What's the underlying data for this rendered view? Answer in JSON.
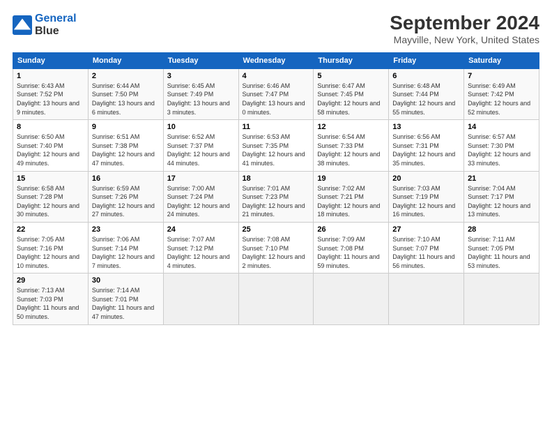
{
  "logo": {
    "line1": "General",
    "line2": "Blue"
  },
  "title": "September 2024",
  "subtitle": "Mayville, New York, United States",
  "days_of_week": [
    "Sunday",
    "Monday",
    "Tuesday",
    "Wednesday",
    "Thursday",
    "Friday",
    "Saturday"
  ],
  "weeks": [
    [
      {
        "day": 1,
        "sunrise": "6:43 AM",
        "sunset": "7:52 PM",
        "daylight": "13 hours and 9 minutes."
      },
      {
        "day": 2,
        "sunrise": "6:44 AM",
        "sunset": "7:50 PM",
        "daylight": "13 hours and 6 minutes."
      },
      {
        "day": 3,
        "sunrise": "6:45 AM",
        "sunset": "7:49 PM",
        "daylight": "13 hours and 3 minutes."
      },
      {
        "day": 4,
        "sunrise": "6:46 AM",
        "sunset": "7:47 PM",
        "daylight": "13 hours and 0 minutes."
      },
      {
        "day": 5,
        "sunrise": "6:47 AM",
        "sunset": "7:45 PM",
        "daylight": "12 hours and 58 minutes."
      },
      {
        "day": 6,
        "sunrise": "6:48 AM",
        "sunset": "7:44 PM",
        "daylight": "12 hours and 55 minutes."
      },
      {
        "day": 7,
        "sunrise": "6:49 AM",
        "sunset": "7:42 PM",
        "daylight": "12 hours and 52 minutes."
      }
    ],
    [
      {
        "day": 8,
        "sunrise": "6:50 AM",
        "sunset": "7:40 PM",
        "daylight": "12 hours and 49 minutes."
      },
      {
        "day": 9,
        "sunrise": "6:51 AM",
        "sunset": "7:38 PM",
        "daylight": "12 hours and 47 minutes."
      },
      {
        "day": 10,
        "sunrise": "6:52 AM",
        "sunset": "7:37 PM",
        "daylight": "12 hours and 44 minutes."
      },
      {
        "day": 11,
        "sunrise": "6:53 AM",
        "sunset": "7:35 PM",
        "daylight": "12 hours and 41 minutes."
      },
      {
        "day": 12,
        "sunrise": "6:54 AM",
        "sunset": "7:33 PM",
        "daylight": "12 hours and 38 minutes."
      },
      {
        "day": 13,
        "sunrise": "6:56 AM",
        "sunset": "7:31 PM",
        "daylight": "12 hours and 35 minutes."
      },
      {
        "day": 14,
        "sunrise": "6:57 AM",
        "sunset": "7:30 PM",
        "daylight": "12 hours and 33 minutes."
      }
    ],
    [
      {
        "day": 15,
        "sunrise": "6:58 AM",
        "sunset": "7:28 PM",
        "daylight": "12 hours and 30 minutes."
      },
      {
        "day": 16,
        "sunrise": "6:59 AM",
        "sunset": "7:26 PM",
        "daylight": "12 hours and 27 minutes."
      },
      {
        "day": 17,
        "sunrise": "7:00 AM",
        "sunset": "7:24 PM",
        "daylight": "12 hours and 24 minutes."
      },
      {
        "day": 18,
        "sunrise": "7:01 AM",
        "sunset": "7:23 PM",
        "daylight": "12 hours and 21 minutes."
      },
      {
        "day": 19,
        "sunrise": "7:02 AM",
        "sunset": "7:21 PM",
        "daylight": "12 hours and 18 minutes."
      },
      {
        "day": 20,
        "sunrise": "7:03 AM",
        "sunset": "7:19 PM",
        "daylight": "12 hours and 16 minutes."
      },
      {
        "day": 21,
        "sunrise": "7:04 AM",
        "sunset": "7:17 PM",
        "daylight": "12 hours and 13 minutes."
      }
    ],
    [
      {
        "day": 22,
        "sunrise": "7:05 AM",
        "sunset": "7:16 PM",
        "daylight": "12 hours and 10 minutes."
      },
      {
        "day": 23,
        "sunrise": "7:06 AM",
        "sunset": "7:14 PM",
        "daylight": "12 hours and 7 minutes."
      },
      {
        "day": 24,
        "sunrise": "7:07 AM",
        "sunset": "7:12 PM",
        "daylight": "12 hours and 4 minutes."
      },
      {
        "day": 25,
        "sunrise": "7:08 AM",
        "sunset": "7:10 PM",
        "daylight": "12 hours and 2 minutes."
      },
      {
        "day": 26,
        "sunrise": "7:09 AM",
        "sunset": "7:08 PM",
        "daylight": "11 hours and 59 minutes."
      },
      {
        "day": 27,
        "sunrise": "7:10 AM",
        "sunset": "7:07 PM",
        "daylight": "11 hours and 56 minutes."
      },
      {
        "day": 28,
        "sunrise": "7:11 AM",
        "sunset": "7:05 PM",
        "daylight": "11 hours and 53 minutes."
      }
    ],
    [
      {
        "day": 29,
        "sunrise": "7:13 AM",
        "sunset": "7:03 PM",
        "daylight": "11 hours and 50 minutes."
      },
      {
        "day": 30,
        "sunrise": "7:14 AM",
        "sunset": "7:01 PM",
        "daylight": "11 hours and 47 minutes."
      },
      null,
      null,
      null,
      null,
      null
    ]
  ]
}
